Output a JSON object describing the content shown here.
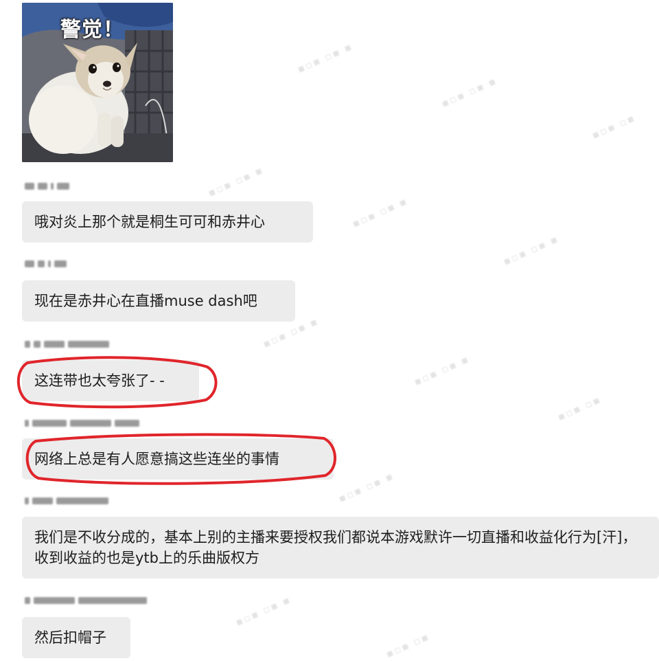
{
  "meme": {
    "caption": "警觉！"
  },
  "messages": [
    {
      "text": "哦对炎上那个就是桐生可可和赤井心",
      "highlighted": false
    },
    {
      "text": "现在是赤井心在直播muse dash吧",
      "highlighted": false
    },
    {
      "text": "这连带也太夸张了- -",
      "highlighted": true
    },
    {
      "text": "网络上总是有人愿意搞这些连坐的事情",
      "highlighted": true
    },
    {
      "text": "我们是不收分成的，基本上别的主播来要授权我们都说本游戏默许一切直播和收益化行为[汗]，收到收益的也是ytb上的乐曲版权方",
      "highlighted": false
    },
    {
      "text": "然后扣帽子",
      "highlighted": false
    }
  ],
  "colors": {
    "bubble": "#ececec",
    "annotation": "#e0252b",
    "background": "#ffffff"
  }
}
